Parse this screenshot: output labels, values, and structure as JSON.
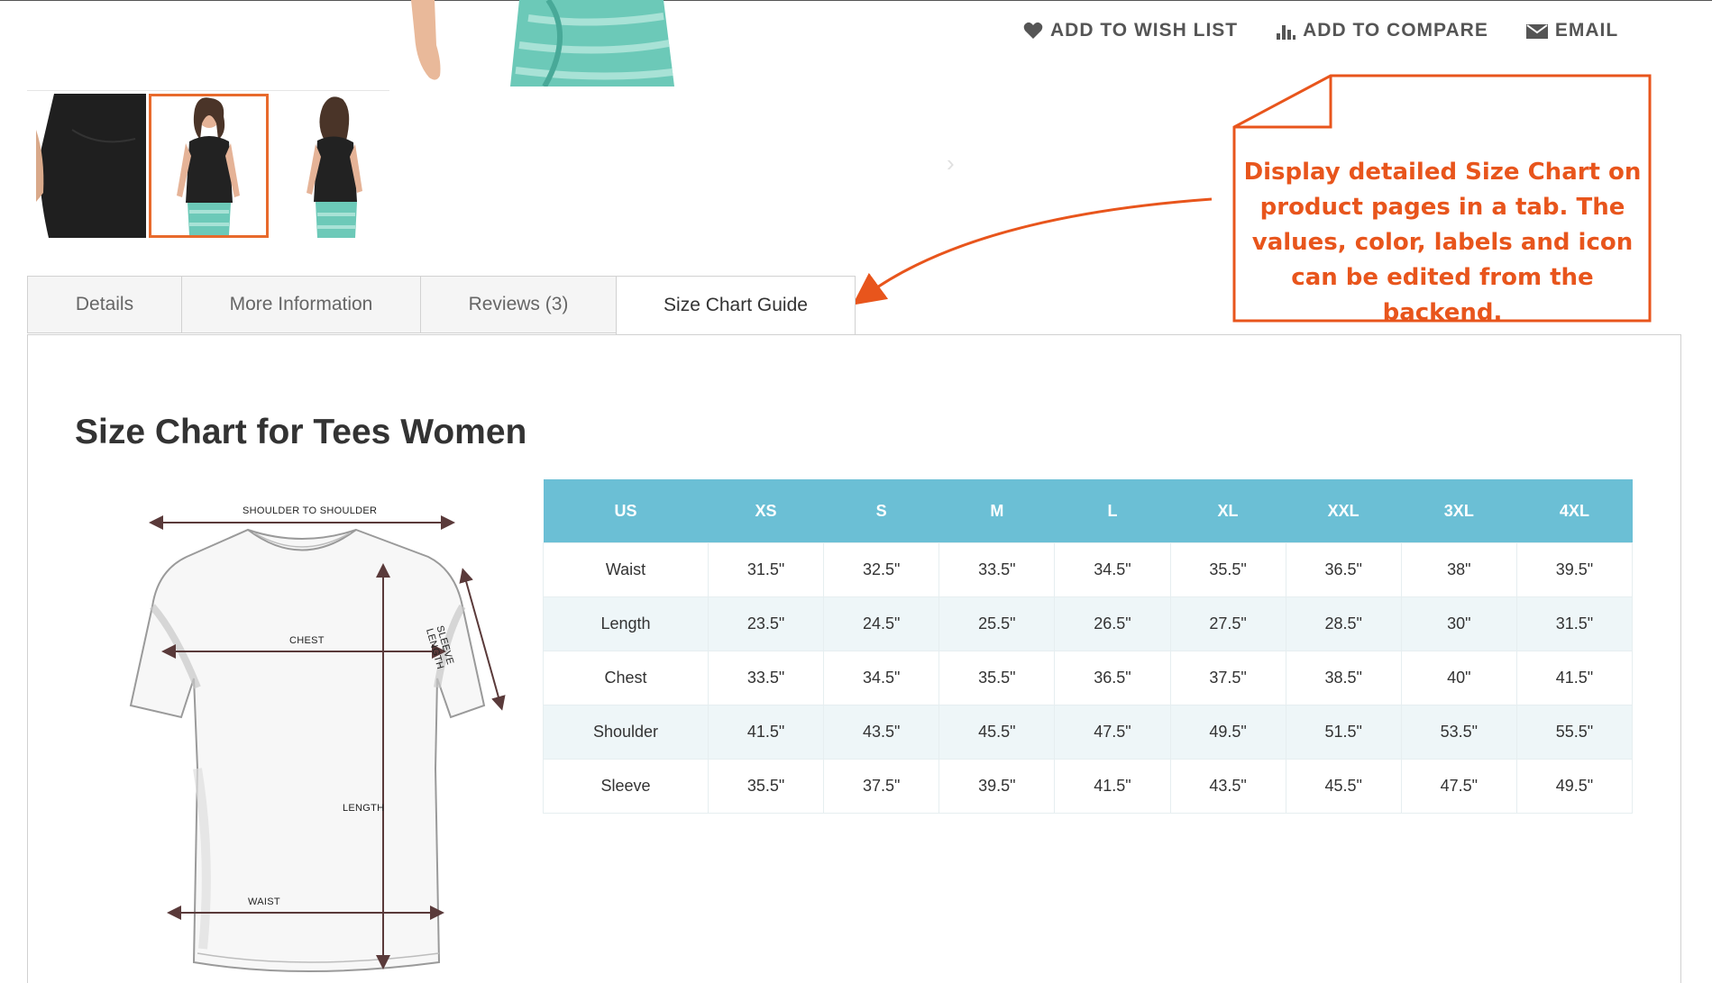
{
  "actions": {
    "wishlist": {
      "label": "ADD TO WISH LIST",
      "icon": "heart-icon"
    },
    "compare": {
      "label": "ADD TO COMPARE",
      "icon": "bar-chart-icon"
    },
    "email": {
      "label": "EMAIL",
      "icon": "envelope-icon"
    }
  },
  "thumbnails": [
    {
      "alt": "back-detail",
      "active": false
    },
    {
      "alt": "front-model",
      "active": true
    },
    {
      "alt": "back-model",
      "active": false
    }
  ],
  "callout": {
    "text": "Display detailed Size Chart on product pages in a tab. The values, color, labels and icon can be edited from the backend.",
    "color": "#e8551c"
  },
  "tabs": [
    {
      "label": "Details",
      "active": false
    },
    {
      "label": "More Information",
      "active": false
    },
    {
      "label": "Reviews (3)",
      "active": false
    },
    {
      "label": "Size Chart Guide",
      "active": true
    }
  ],
  "size_chart": {
    "title": "Size Chart for Tees Women",
    "header_color": "#6bbfd5",
    "diagram_labels": {
      "shoulder": "SHOULDER TO SHOULDER",
      "sleeve": "SLEEVE LENGTH",
      "chest": "CHEST",
      "length": "LENGTH",
      "waist": "WAIST"
    },
    "columns": [
      "US",
      "XS",
      "S",
      "M",
      "L",
      "XL",
      "XXL",
      "3XL",
      "4XL"
    ],
    "rows": [
      {
        "label": "Waist",
        "values": [
          "31.5\"",
          "32.5\"",
          "33.5\"",
          "34.5\"",
          "35.5\"",
          "36.5\"",
          "38\"",
          "39.5\""
        ]
      },
      {
        "label": "Length",
        "values": [
          "23.5\"",
          "24.5\"",
          "25.5\"",
          "26.5\"",
          "27.5\"",
          "28.5\"",
          "30\"",
          "31.5\""
        ]
      },
      {
        "label": "Chest",
        "values": [
          "33.5\"",
          "34.5\"",
          "35.5\"",
          "36.5\"",
          "37.5\"",
          "38.5\"",
          "40\"",
          "41.5\""
        ]
      },
      {
        "label": "Shoulder",
        "values": [
          "41.5\"",
          "43.5\"",
          "45.5\"",
          "47.5\"",
          "49.5\"",
          "51.5\"",
          "53.5\"",
          "55.5\""
        ]
      },
      {
        "label": "Sleeve",
        "values": [
          "35.5\"",
          "37.5\"",
          "39.5\"",
          "41.5\"",
          "43.5\"",
          "45.5\"",
          "47.5\"",
          "49.5\""
        ]
      }
    ]
  }
}
